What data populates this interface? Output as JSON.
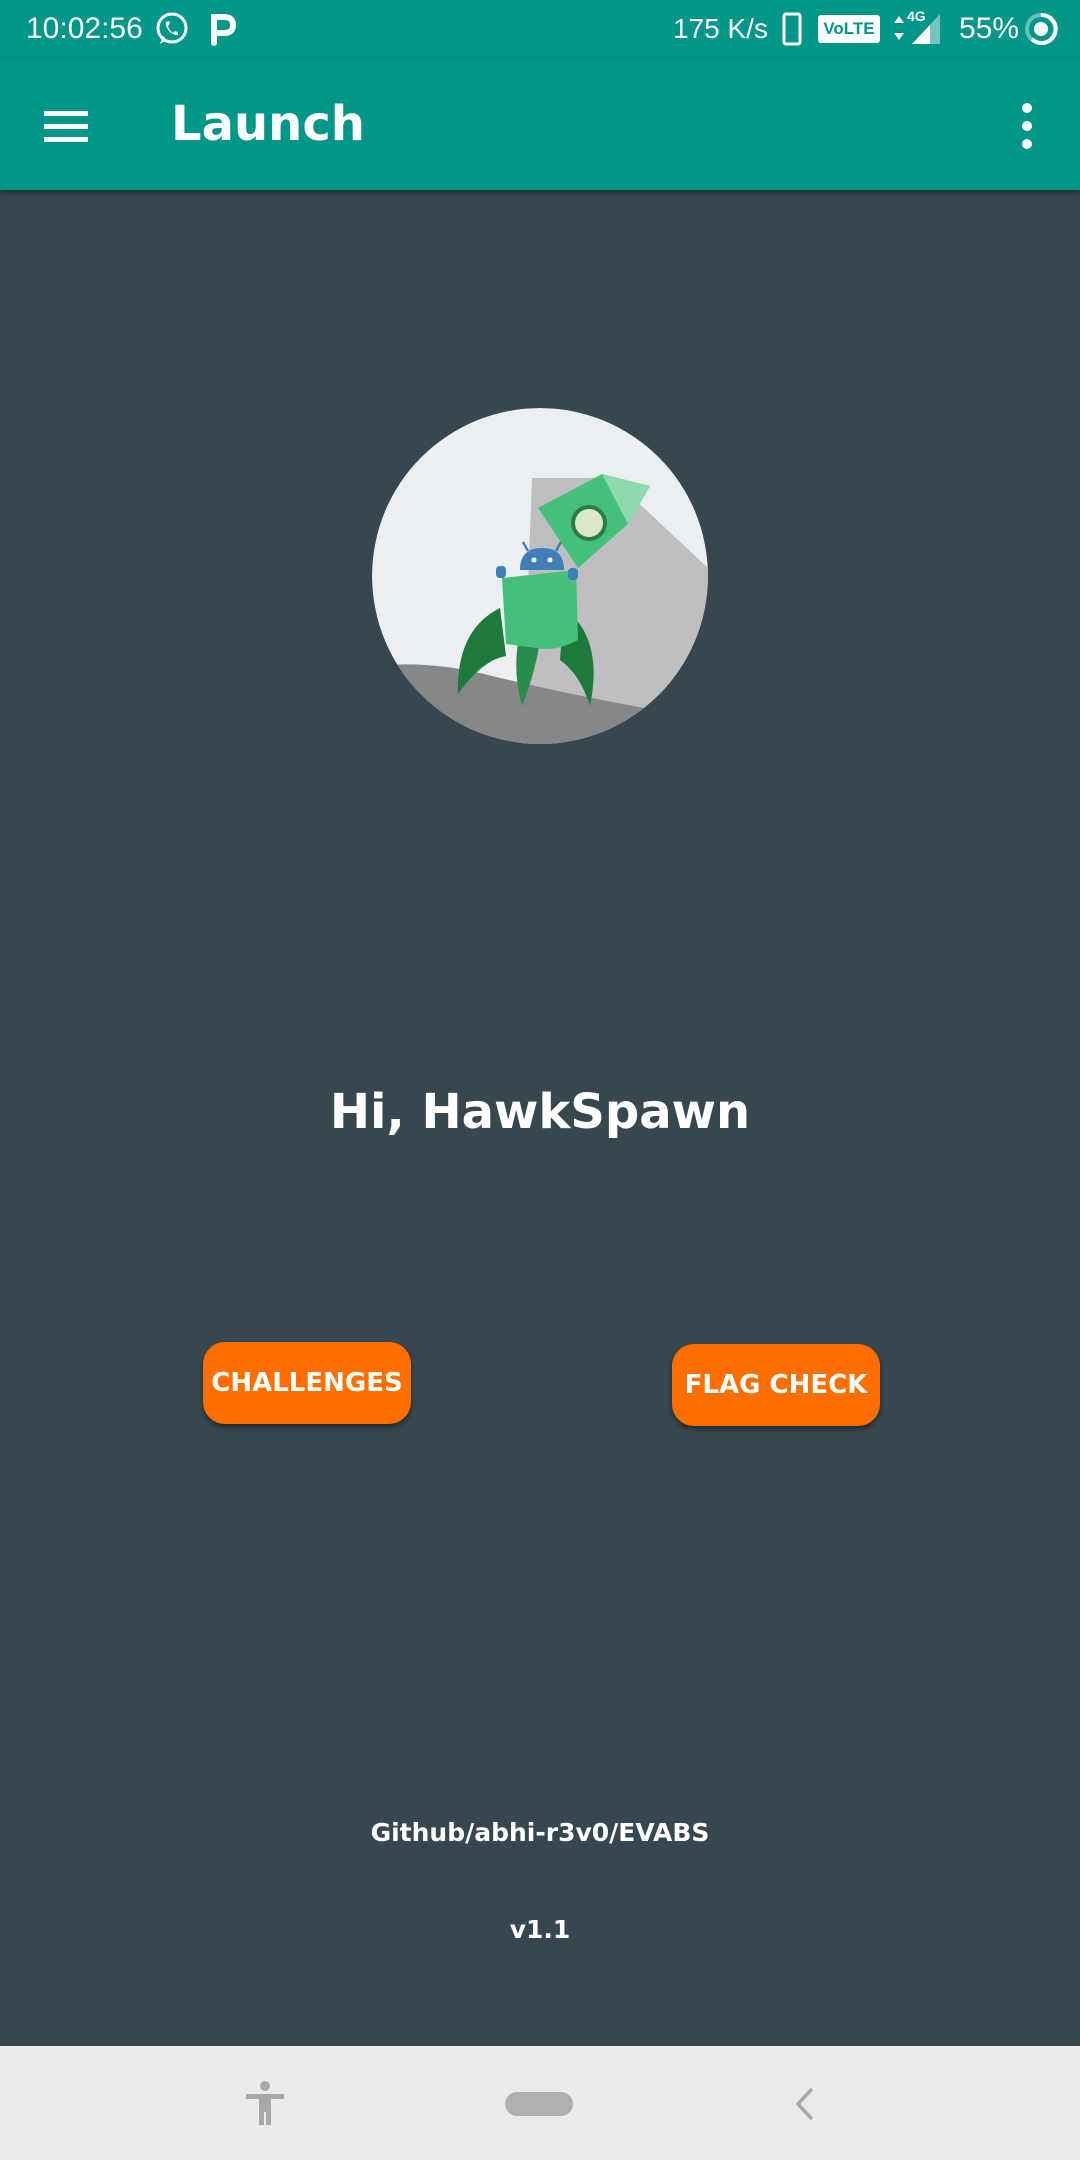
{
  "status_bar": {
    "time": "10:02:56",
    "network_speed": "175 K/s",
    "volte_label": "VoLTE",
    "network_type": "4G",
    "battery": "55%",
    "icons": [
      "whatsapp-icon",
      "parking-icon",
      "phone-icon",
      "volte-icon",
      "signal-icon",
      "battery-icon"
    ]
  },
  "app_bar": {
    "title": "Launch",
    "menu_icon": "hamburger-menu-icon",
    "overflow_icon": "more-vert-icon"
  },
  "main": {
    "logo_icon": "rocket-android-logo",
    "greeting": "Hi, HawkSpawn",
    "buttons": {
      "challenges": "CHALLENGES",
      "flag_check": "FLAG CHECK"
    },
    "footer": {
      "link": "Github/abhi-r3v0/EVABS",
      "version": "v1.1"
    }
  },
  "nav_bar": {
    "icons": [
      "accessibility-icon",
      "home-pill-icon",
      "back-icon"
    ]
  },
  "colors": {
    "primary": "#009688",
    "background": "#37474f",
    "accent": "#ff6f00",
    "nav_bar": "#ebebeb"
  }
}
